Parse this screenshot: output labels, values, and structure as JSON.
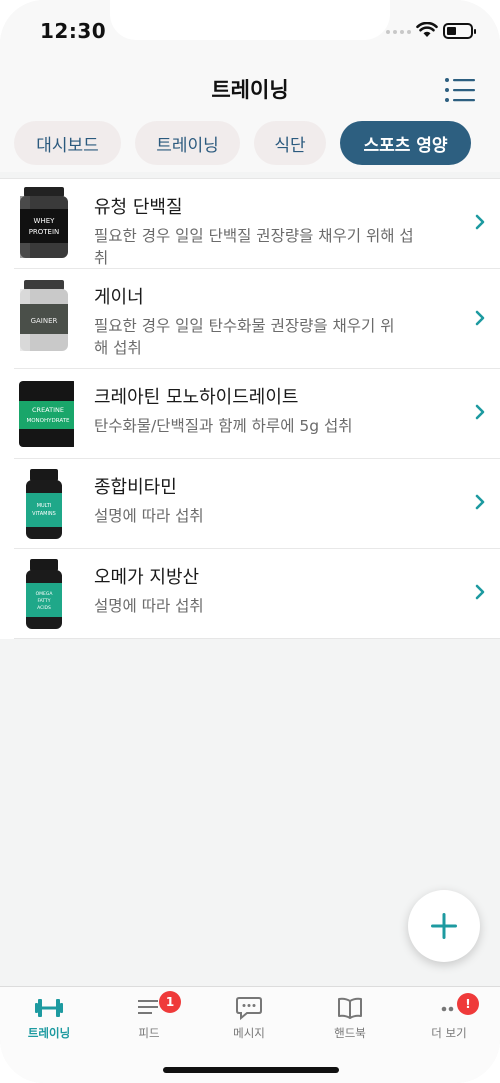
{
  "status": {
    "time": "12:30"
  },
  "header": {
    "title": "트레이닝",
    "tabs": [
      {
        "label": "대시보드",
        "active": false
      },
      {
        "label": "트레이닝",
        "active": false
      },
      {
        "label": "식단",
        "active": false
      },
      {
        "label": "스포츠 영양",
        "active": true
      }
    ]
  },
  "supplements": [
    {
      "name": "유청 단백질",
      "desc": "필요한 경우 일일 단백질 권장량을 채우기 위해 섭취",
      "icon": "whey-protein-jar",
      "label": "WHEY PROTEIN"
    },
    {
      "name": "게이너",
      "desc": "필요한 경우 일일 탄수화물 권장량을 채우기 위해 섭취",
      "icon": "gainer-jar",
      "label": "GAINER"
    },
    {
      "name": "크레아틴 모노하이드레이트",
      "desc": "탄수화물/단백질과 함께 하루에 5g 섭취",
      "icon": "creatine-jar",
      "label": "CREATINE MONOHYDRATE"
    },
    {
      "name": "종합비타민",
      "desc": "설명에 따라 섭취",
      "icon": "multivitamin-bottle",
      "label": "MULTI VITAMINS"
    },
    {
      "name": "오메가 지방산",
      "desc": "설명에 따라 섭취",
      "icon": "omega-bottle",
      "label": "OMEGA FATTY ACIDS"
    }
  ],
  "tabbar": {
    "items": [
      {
        "label": "트레이닝",
        "icon": "dumbbell-icon",
        "active": true
      },
      {
        "label": "피드",
        "icon": "feed-icon",
        "badge": "1"
      },
      {
        "label": "메시지",
        "icon": "chat-icon"
      },
      {
        "label": "핸드북",
        "icon": "book-icon"
      },
      {
        "label": "더 보기",
        "icon": "more-icon",
        "badge": "!"
      }
    ]
  },
  "colors": {
    "accent": "#1d9aa0",
    "tab_active": "#2d5f80",
    "badge": "#ef3a3a"
  }
}
